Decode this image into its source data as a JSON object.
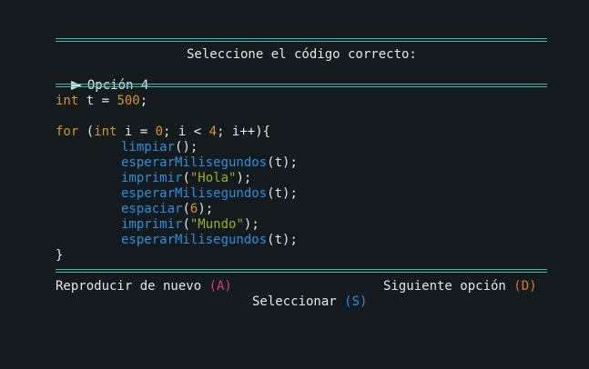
{
  "header": {
    "prompt": "Seleccione el código correcto:",
    "current_option": "Opción 4"
  },
  "code": {
    "line1": {
      "kw": "int",
      "rest": " t = ",
      "num": "500",
      "end": ";"
    },
    "line3": {
      "kw1": "for",
      "p1": " (",
      "kw2": "int",
      "p2": " i = ",
      "num1": "0",
      "p3": "; i < ",
      "num2": "4",
      "p4": "; i++){"
    },
    "body": [
      {
        "fn": "limpiar",
        "open": "(",
        "arg": "",
        "close": ");"
      },
      {
        "fn": "esperarMilisegundos",
        "open": "(",
        "arg": "t",
        "close": ");"
      },
      {
        "fn": "imprimir",
        "open": "(",
        "arg": "\"Hola\"",
        "close": ");"
      },
      {
        "fn": "esperarMilisegundos",
        "open": "(",
        "arg": "t",
        "close": ");"
      },
      {
        "fn": "espaciar",
        "open": "(",
        "arg": "6",
        "close": ");"
      },
      {
        "fn": "imprimir",
        "open": "(",
        "arg": "\"Mundo\"",
        "close": ");"
      },
      {
        "fn": "esperarMilisegundos",
        "open": "(",
        "arg": "t",
        "close": ");"
      }
    ],
    "closing": "}"
  },
  "footer": {
    "replay_label": "Reproducir de nuevo ",
    "replay_key": "(A)",
    "next_label": "Siguiente opción ",
    "next_key": "(D)",
    "select_label": "Seleccionar ",
    "select_key": "(S)"
  },
  "colors": {
    "accent_rule": "#3fb8b0",
    "keyword": "#d4932a",
    "function": "#2e8fd8",
    "string": "#95b21a"
  }
}
